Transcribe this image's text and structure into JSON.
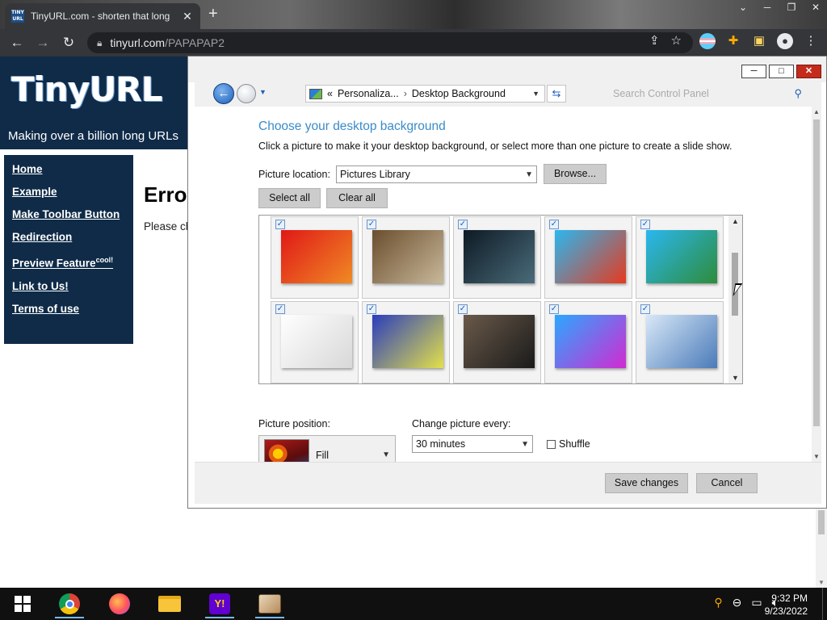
{
  "browser": {
    "tab_title": "TinyURL.com - shorten that long",
    "tab_favicon": "TINY URL",
    "url_domain": "tinyurl.com",
    "url_path": "/PAPAPAP2",
    "new_tab_label": "+",
    "icons": [
      "back-icon",
      "forward-icon",
      "reload-icon",
      "lock-icon",
      "share-icon",
      "star-icon",
      "profile-avatar"
    ]
  },
  "tinyurl": {
    "logo": "TinyURL",
    "tagline": "Making over a billion long URLs",
    "nav": [
      {
        "label": "Home"
      },
      {
        "label": "Example"
      },
      {
        "label": "Make Toolbar Button"
      },
      {
        "label": "Redirection"
      },
      {
        "label": "Preview Feature",
        "sup": "cool!"
      },
      {
        "label": "Link to Us!"
      },
      {
        "label": "Terms of use"
      }
    ],
    "error_heading": "Erro",
    "error_text": "Please ch"
  },
  "control_panel": {
    "breadcrumb": {
      "prefix": "«",
      "parent": "Personaliza...",
      "separator": "›",
      "current": "Desktop Background"
    },
    "search_placeholder": "Search Control Panel",
    "heading": "Choose your desktop background",
    "description": "Click a picture to make it your desktop background, or select more than one picture to create a slide show.",
    "picture_location_label": "Picture location:",
    "picture_location_value": "Pictures Library",
    "browse_label": "Browse...",
    "select_all_label": "Select all",
    "clear_all_label": "Clear all",
    "picture_position_label": "Picture position:",
    "picture_position_value": "Fill",
    "change_every_label": "Change picture every:",
    "change_every_value": "30 minutes",
    "shuffle_label": "Shuffle",
    "shuffle_checked": false,
    "save_label": "Save changes",
    "cancel_label": "Cancel",
    "check_mark": "✓",
    "gallery": [
      {
        "name": "cartoon-fox-red-image",
        "checked": true,
        "colors": [
          "#e01818",
          "#f08a24"
        ]
      },
      {
        "name": "toilet-urinal-image",
        "checked": true,
        "colors": [
          "#6a4e2e",
          "#c9b89a"
        ]
      },
      {
        "name": "movie-cover-image",
        "checked": true,
        "colors": [
          "#0d1a24",
          "#4a6b7a"
        ]
      },
      {
        "name": "comic-sunglasses-man-image",
        "checked": true,
        "colors": [
          "#2ab7f0",
          "#e63a1e"
        ]
      },
      {
        "name": "comic-sunglasses-man-2-image",
        "checked": true,
        "colors": [
          "#2ab7f0",
          "#2e8c3a"
        ]
      },
      {
        "name": "line-drawing-image",
        "checked": true,
        "colors": [
          "#ffffff",
          "#d8d8d8"
        ]
      },
      {
        "name": "man-portrait-colorful-image",
        "checked": true,
        "colors": [
          "#2a3dbd",
          "#e3e04a"
        ]
      },
      {
        "name": "man-in-suit-image",
        "checked": true,
        "colors": [
          "#6a5a4a",
          "#1a1a1a"
        ]
      },
      {
        "name": "gradient-badge-image",
        "checked": true,
        "colors": [
          "#2aa8ff",
          "#d22ad2"
        ]
      },
      {
        "name": "blue-figure-image",
        "checked": true,
        "colors": [
          "#d8e8f8",
          "#4a7ab8"
        ]
      }
    ]
  },
  "taskbar": {
    "time": "9:32 PM",
    "date": "9/23/2022",
    "apps": [
      "start-button",
      "chrome-app",
      "firefox-app",
      "file-explorer-app",
      "yahoo-app",
      "misc-app"
    ]
  }
}
